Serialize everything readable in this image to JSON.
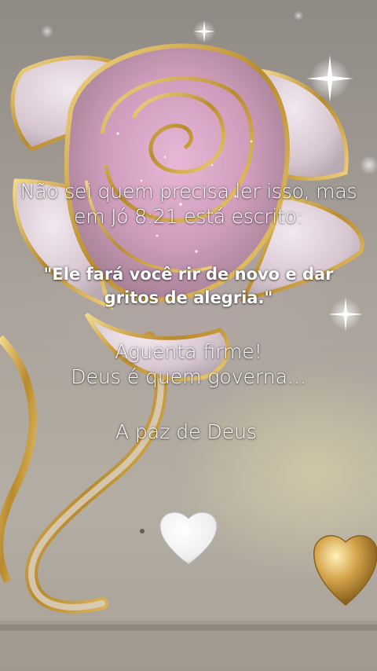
{
  "message": {
    "intro_line1": "Não sei quem precisa ler isso, mas",
    "intro_line2": "em Jó 8:21 está escrito:",
    "quote_line1": "\"Ele fará você rir de novo e dar",
    "quote_line2": "gritos de alegria.\"",
    "encourage_line1": "Aguenta firme!",
    "encourage_line2": "Deus é quem governa...",
    "closing": "A paz de Deus"
  },
  "decor": {
    "heart_emoji_icon": "white-heart-icon",
    "gold_heart_icon": "gold-heart-icon",
    "rose_icon": "rose-icon"
  },
  "colors": {
    "text": "#ffffff",
    "gold": "#c9a24a",
    "rose_pink": "#d9a6c6",
    "background": "#a9a39b"
  }
}
